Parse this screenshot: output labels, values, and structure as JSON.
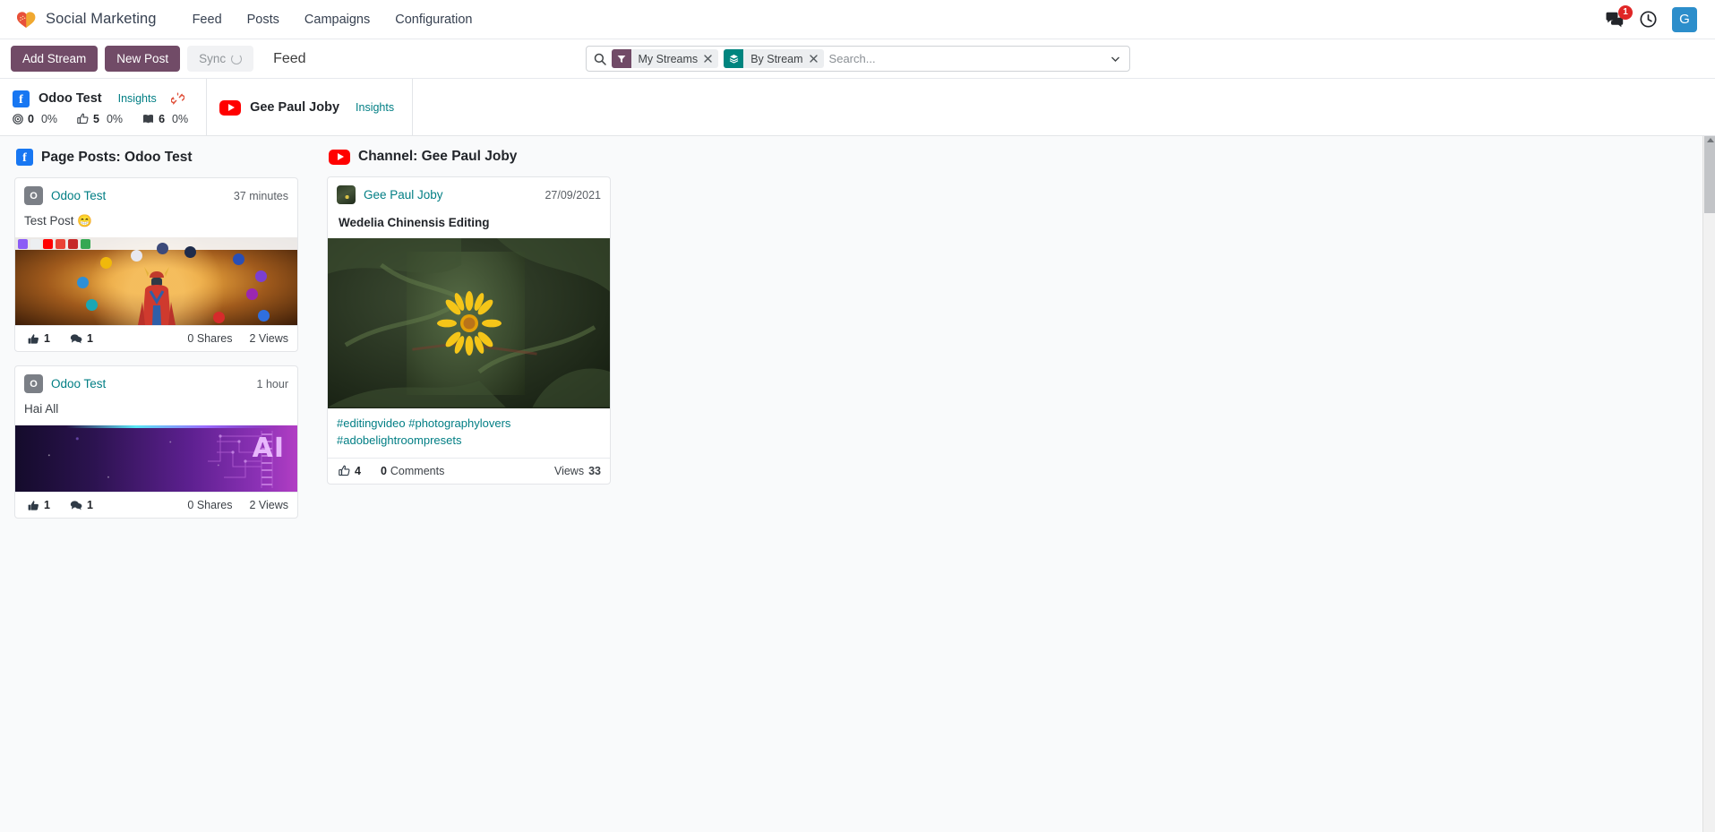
{
  "navbar": {
    "brand": "Social Marketing",
    "logo_icon": "heart-logo",
    "menu": [
      {
        "label": "Feed"
      },
      {
        "label": "Posts"
      },
      {
        "label": "Campaigns"
      },
      {
        "label": "Configuration"
      }
    ],
    "messages_icon": "messages-icon",
    "messages_badge": "1",
    "activities_icon": "clock-icon",
    "user_avatar_initial": "G"
  },
  "control_panel": {
    "add_stream_label": "Add Stream",
    "new_post_label": "New Post",
    "sync_label": "Sync",
    "sync_icon": "spinner-icon",
    "page_title": "Feed"
  },
  "search": {
    "search_icon": "search-icon",
    "placeholder": "Search...",
    "value": "",
    "dropdown_icon": "chevron-down-icon",
    "facets": [
      {
        "label": "My Streams",
        "icon": "filter-icon",
        "color": "#714b67",
        "remove_icon": "close-icon"
      },
      {
        "label": "By Stream",
        "icon": "layers-icon",
        "color": "#00857f",
        "remove_icon": "close-icon"
      }
    ]
  },
  "accounts": [
    {
      "platform_icon": "facebook-icon",
      "name": "Odoo Test",
      "insights_label": "Insights",
      "unlink_icon": "broken-link-icon",
      "stats": [
        {
          "icon": "target-icon",
          "value": "0",
          "percent": "0%"
        },
        {
          "icon": "thumbs-up-icon",
          "value": "5",
          "percent": "0%"
        },
        {
          "icon": "story-icon",
          "value": "6",
          "percent": "0%"
        }
      ]
    },
    {
      "platform_icon": "youtube-icon",
      "name": "Gee Paul Joby",
      "insights_label": "Insights",
      "stats": []
    }
  ],
  "streams": [
    {
      "platform_icon": "facebook-icon",
      "title": "Page Posts: Odoo Test",
      "posts": [
        {
          "avatar_initial": "O",
          "author": "Odoo Test",
          "time": "37 minutes",
          "message": "Test Post 😁",
          "media": "samurai-crypto-image",
          "footer": {
            "likes_icon": "thumbs-up-icon",
            "likes": "1",
            "comments_icon": "comment-icon",
            "comments": "1",
            "shares": "0 Shares",
            "views": "2 Views"
          }
        },
        {
          "avatar_initial": "O",
          "author": "Odoo Test",
          "time": "1 hour",
          "message": "Hai All",
          "media": "ai-circuit-image",
          "footer": {
            "likes_icon": "thumbs-up-icon",
            "likes": "1",
            "comments_icon": "comment-icon",
            "comments": "1",
            "shares": "0 Shares",
            "views": "2 Views"
          }
        }
      ]
    },
    {
      "platform_icon": "youtube-icon",
      "title": "Channel: Gee Paul Joby",
      "posts": [
        {
          "avatar_initial": "",
          "author": "Gee Paul Joby",
          "time": "27/09/2021",
          "video_title": "Wedelia Chinensis Editing",
          "media": "yellow-flower-video-thumbnail",
          "hashtags": "#editingvideo #photographylovers #adobelightroompresets",
          "footer": {
            "likes_icon": "thumbs-up-icon",
            "likes": "4",
            "comments_count": "0",
            "comments_label": "Comments",
            "views_label": "Views",
            "views_count": "33"
          }
        }
      ]
    }
  ],
  "colors": {
    "primary": "#714b67",
    "teal": "#017e84",
    "facebook": "#1877f2",
    "youtube": "#ff0000",
    "badge_red": "#e02626",
    "avatar_blue": "#2c8ecb"
  }
}
